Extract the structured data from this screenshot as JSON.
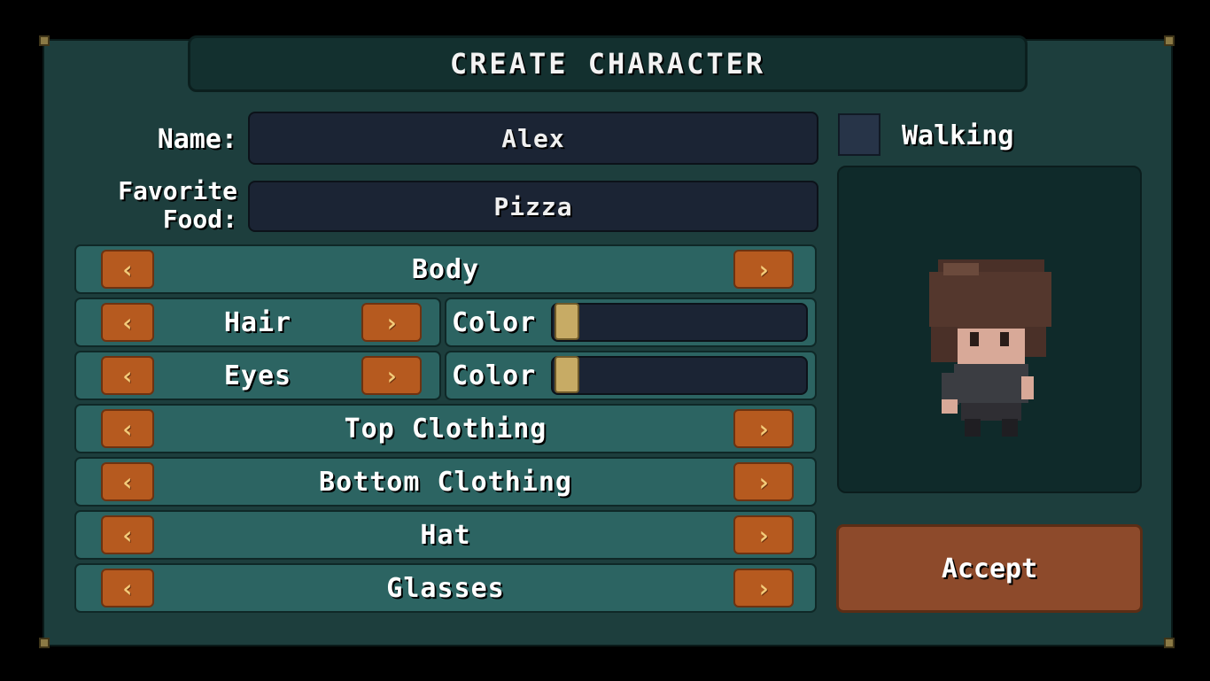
{
  "title": "CREATE CHARACTER",
  "form": {
    "name_label": "Name:",
    "name_value": "Alex",
    "food_label_line1": "Favorite",
    "food_label_line2": "Food:",
    "food_value": "Pizza"
  },
  "options": {
    "prev_glyph": "‹",
    "next_glyph": "›",
    "body": "Body",
    "hair": "Hair",
    "eyes": "Eyes",
    "color": "Color",
    "top_clothing": "Top Clothing",
    "bottom_clothing": "Bottom Clothing",
    "hat": "Hat",
    "glasses": "Glasses"
  },
  "preview": {
    "walking_label": "Walking",
    "walking_checked": false
  },
  "accept_label": "Accept",
  "colors": {
    "panel": "#1d3e3d",
    "row": "#2c6462",
    "arrow": "#b65a1f",
    "accept": "#8d4a2b",
    "input": "#1b2434"
  }
}
